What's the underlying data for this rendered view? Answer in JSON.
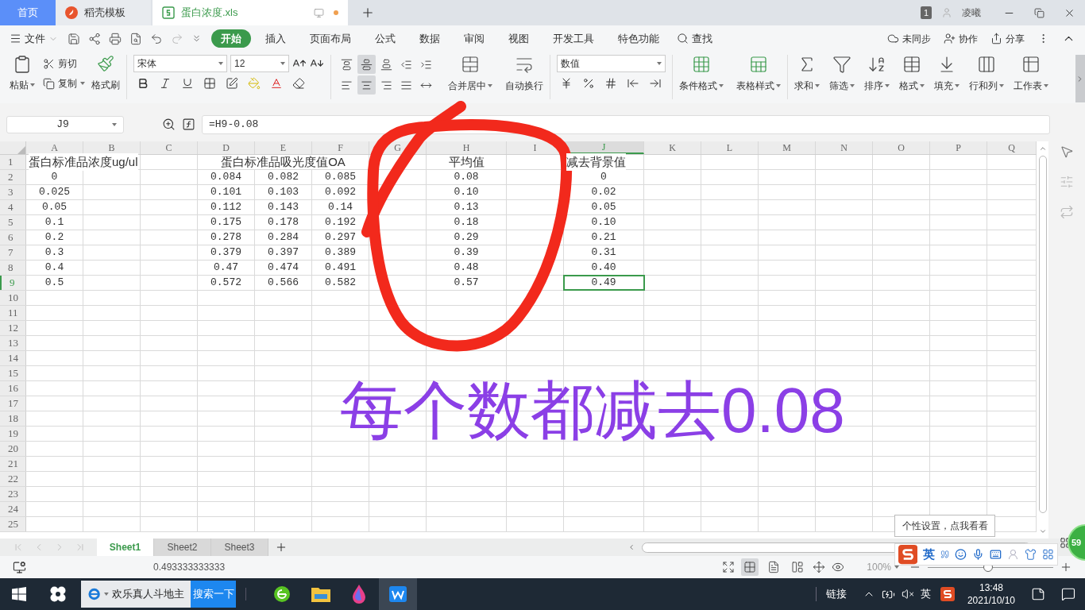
{
  "tabs": [
    {
      "label": "首页",
      "kind": "home",
      "selected": false
    },
    {
      "label": "稻壳模板",
      "kind": "docer",
      "selected": false
    },
    {
      "label": "蛋白浓度.xls",
      "kind": "sheet",
      "selected": true
    }
  ],
  "window": {
    "badge": "1",
    "user": "凌曦"
  },
  "menu": {
    "file": "文件",
    "items": [
      {
        "label": "开始",
        "selected": true
      },
      {
        "label": "插入",
        "selected": false
      },
      {
        "label": "页面布局",
        "selected": false
      },
      {
        "label": "公式",
        "selected": false
      },
      {
        "label": "数据",
        "selected": false
      },
      {
        "label": "审阅",
        "selected": false
      },
      {
        "label": "视图",
        "selected": false
      },
      {
        "label": "开发工具",
        "selected": false
      },
      {
        "label": "特色功能",
        "selected": false
      }
    ],
    "search": "查找",
    "actions": [
      {
        "label": "未同步",
        "kind": "cloud"
      },
      {
        "label": "协作",
        "kind": "user"
      },
      {
        "label": "分享",
        "kind": "share"
      }
    ]
  },
  "ribbon": {
    "clipboard": [
      {
        "label": "粘贴",
        "kind": "paste"
      },
      {
        "label": "剪切",
        "kind": "cut"
      },
      {
        "label": "复制",
        "kind": "copy"
      },
      {
        "label": "格式刷",
        "kind": "brush"
      }
    ],
    "font": {
      "name": "宋体",
      "size": "12"
    },
    "align_buttons": [
      {
        "kind": "top",
        "selected": false
      },
      {
        "kind": "middle",
        "selected": true
      },
      {
        "kind": "bottom",
        "selected": false
      },
      {
        "kind": "outdent",
        "selected": false
      },
      {
        "kind": "indent",
        "selected": false
      },
      {
        "kind": "left",
        "selected": false
      },
      {
        "kind": "center",
        "selected": true
      },
      {
        "kind": "right",
        "selected": false
      },
      {
        "kind": "justify",
        "selected": false
      },
      {
        "kind": "distribute",
        "selected": false
      }
    ],
    "merge": [
      {
        "label": "合并居中",
        "kind": "merge",
        "dropdown": true
      },
      {
        "label": "自动换行",
        "kind": "wrap",
        "dropdown": false
      }
    ],
    "number_format": "数值",
    "style_buttons": [
      {
        "label": "条件格式",
        "kind": "cond",
        "dropdown": true
      },
      {
        "label": "表格样式",
        "kind": "tablestyle",
        "dropdown": true
      }
    ],
    "tools": [
      {
        "label": "求和",
        "kind": "sum"
      },
      {
        "label": "筛选",
        "kind": "filter"
      },
      {
        "label": "排序",
        "kind": "sort"
      },
      {
        "label": "格式",
        "kind": "format"
      },
      {
        "label": "填充",
        "kind": "fill"
      },
      {
        "label": "行和列",
        "kind": "rowcol"
      },
      {
        "label": "工作表",
        "kind": "sheet"
      }
    ]
  },
  "formula_bar": {
    "cell": "J9",
    "formula": "=H9-0.08"
  },
  "sheet": {
    "columns": [
      {
        "label": "A",
        "selected": false
      },
      {
        "label": "B",
        "selected": false
      },
      {
        "label": "C",
        "selected": false
      },
      {
        "label": "D",
        "selected": false
      },
      {
        "label": "E",
        "selected": false
      },
      {
        "label": "F",
        "selected": false
      },
      {
        "label": "G",
        "selected": false
      },
      {
        "label": "H",
        "selected": false
      },
      {
        "label": "I",
        "selected": false
      },
      {
        "label": "J",
        "selected": true
      },
      {
        "label": "K",
        "selected": false
      },
      {
        "label": "L",
        "selected": false
      },
      {
        "label": "M",
        "selected": false
      },
      {
        "label": "N",
        "selected": false
      },
      {
        "label": "O",
        "selected": false
      },
      {
        "label": "P",
        "selected": false
      },
      {
        "label": "Q",
        "selected": false
      }
    ],
    "rows": [
      {
        "label": "1",
        "selected": false,
        "cells": [
          "蛋白标准品浓度ug/ul",
          null,
          null,
          "蛋白标准品吸光度值OA",
          null,
          null,
          null,
          "平均值",
          null,
          "减去背景值"
        ]
      },
      {
        "label": "2",
        "selected": false,
        "cells": [
          "0",
          null,
          null,
          "0.084",
          "0.082",
          "0.085",
          null,
          "0.08",
          null,
          "0"
        ]
      },
      {
        "label": "3",
        "selected": false,
        "cells": [
          "0.025",
          null,
          null,
          "0.101",
          "0.103",
          "0.092",
          null,
          "0.10",
          null,
          "0.02"
        ]
      },
      {
        "label": "4",
        "selected": false,
        "cells": [
          "0.05",
          null,
          null,
          "0.112",
          "0.143",
          "0.14",
          null,
          "0.13",
          null,
          "0.05"
        ]
      },
      {
        "label": "5",
        "selected": false,
        "cells": [
          "0.1",
          null,
          null,
          "0.175",
          "0.178",
          "0.192",
          null,
          "0.18",
          null,
          "0.10"
        ]
      },
      {
        "label": "6",
        "selected": false,
        "cells": [
          "0.2",
          null,
          null,
          "0.278",
          "0.284",
          "0.297",
          null,
          "0.29",
          null,
          "0.21"
        ]
      },
      {
        "label": "7",
        "selected": false,
        "cells": [
          "0.3",
          null,
          null,
          "0.379",
          "0.397",
          "0.389",
          null,
          "0.39",
          null,
          "0.31"
        ]
      },
      {
        "label": "8",
        "selected": false,
        "cells": [
          "0.4",
          null,
          null,
          "0.47",
          "0.474",
          "0.491",
          null,
          "0.48",
          null,
          "0.40"
        ]
      },
      {
        "label": "9",
        "selected": true,
        "cells": [
          "0.5",
          null,
          null,
          "0.572",
          "0.566",
          "0.582",
          null,
          "0.57",
          null,
          "0.49"
        ]
      },
      {
        "label": "10",
        "selected": false
      },
      {
        "label": "11",
        "selected": false
      },
      {
        "label": "12",
        "selected": false
      },
      {
        "label": "13",
        "selected": false
      },
      {
        "label": "14",
        "selected": false
      },
      {
        "label": "15",
        "selected": false
      },
      {
        "label": "16",
        "selected": false
      },
      {
        "label": "17",
        "selected": false
      },
      {
        "label": "18",
        "selected": false
      },
      {
        "label": "19",
        "selected": false
      },
      {
        "label": "20",
        "selected": false
      },
      {
        "label": "21",
        "selected": false
      },
      {
        "label": "22",
        "selected": false
      },
      {
        "label": "23",
        "selected": false
      },
      {
        "label": "24",
        "selected": false
      },
      {
        "label": "25",
        "selected": false
      }
    ]
  },
  "sheet_tabs": [
    {
      "label": "Sheet1",
      "selected": true
    },
    {
      "label": "Sheet2",
      "selected": false
    },
    {
      "label": "Sheet3",
      "selected": false
    }
  ],
  "status": {
    "value": "0.493333333333",
    "zoom": "100%",
    "level": 0.48,
    "view_modes": [
      {
        "kind": "normal",
        "selected": true
      },
      {
        "kind": "page",
        "selected": false
      },
      {
        "kind": "break",
        "selected": false
      }
    ]
  },
  "ime": {
    "tooltip": "个性设置，点我看看",
    "mode": "英"
  },
  "score_badge": "59",
  "taskbar": {
    "search": "欢乐真人斗地主",
    "search_button": "搜索一下",
    "link": "链接",
    "lang": "英",
    "time": "13:48",
    "date": "2021/10/10"
  },
  "annotation": {
    "text": "每个数都减去0.08"
  }
}
